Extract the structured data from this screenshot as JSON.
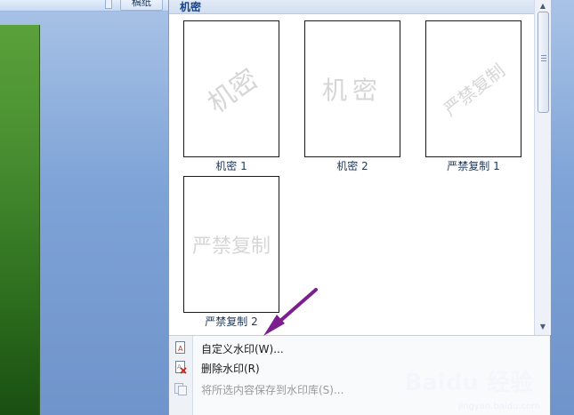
{
  "ribbon": {
    "button_label": "稿纸"
  },
  "gallery": {
    "header": "机密",
    "items": [
      {
        "label": "机密 1",
        "watermark": "机密"
      },
      {
        "label": "机密 2",
        "watermark": "机密"
      },
      {
        "label": "严禁复制 1",
        "watermark": "严禁复制"
      },
      {
        "label": "严禁复制 2",
        "watermark": "严禁复制"
      }
    ]
  },
  "menu": {
    "items": [
      {
        "label": "自定义水印(W)...",
        "enabled": true,
        "icon": "custom-watermark-icon"
      },
      {
        "label": "删除水印(R)",
        "enabled": true,
        "icon": "remove-watermark-icon"
      },
      {
        "label": "将所选内容保存到水印库(S)...",
        "enabled": false,
        "icon": "save-to-gallery-icon"
      }
    ]
  },
  "site_watermark": {
    "brand": "Baidu 经验",
    "url": "jingyan.baidu.com"
  },
  "colors": {
    "header_text": "#15428b",
    "arrow": "#7b1f8f",
    "document_green": "#4a9032"
  }
}
